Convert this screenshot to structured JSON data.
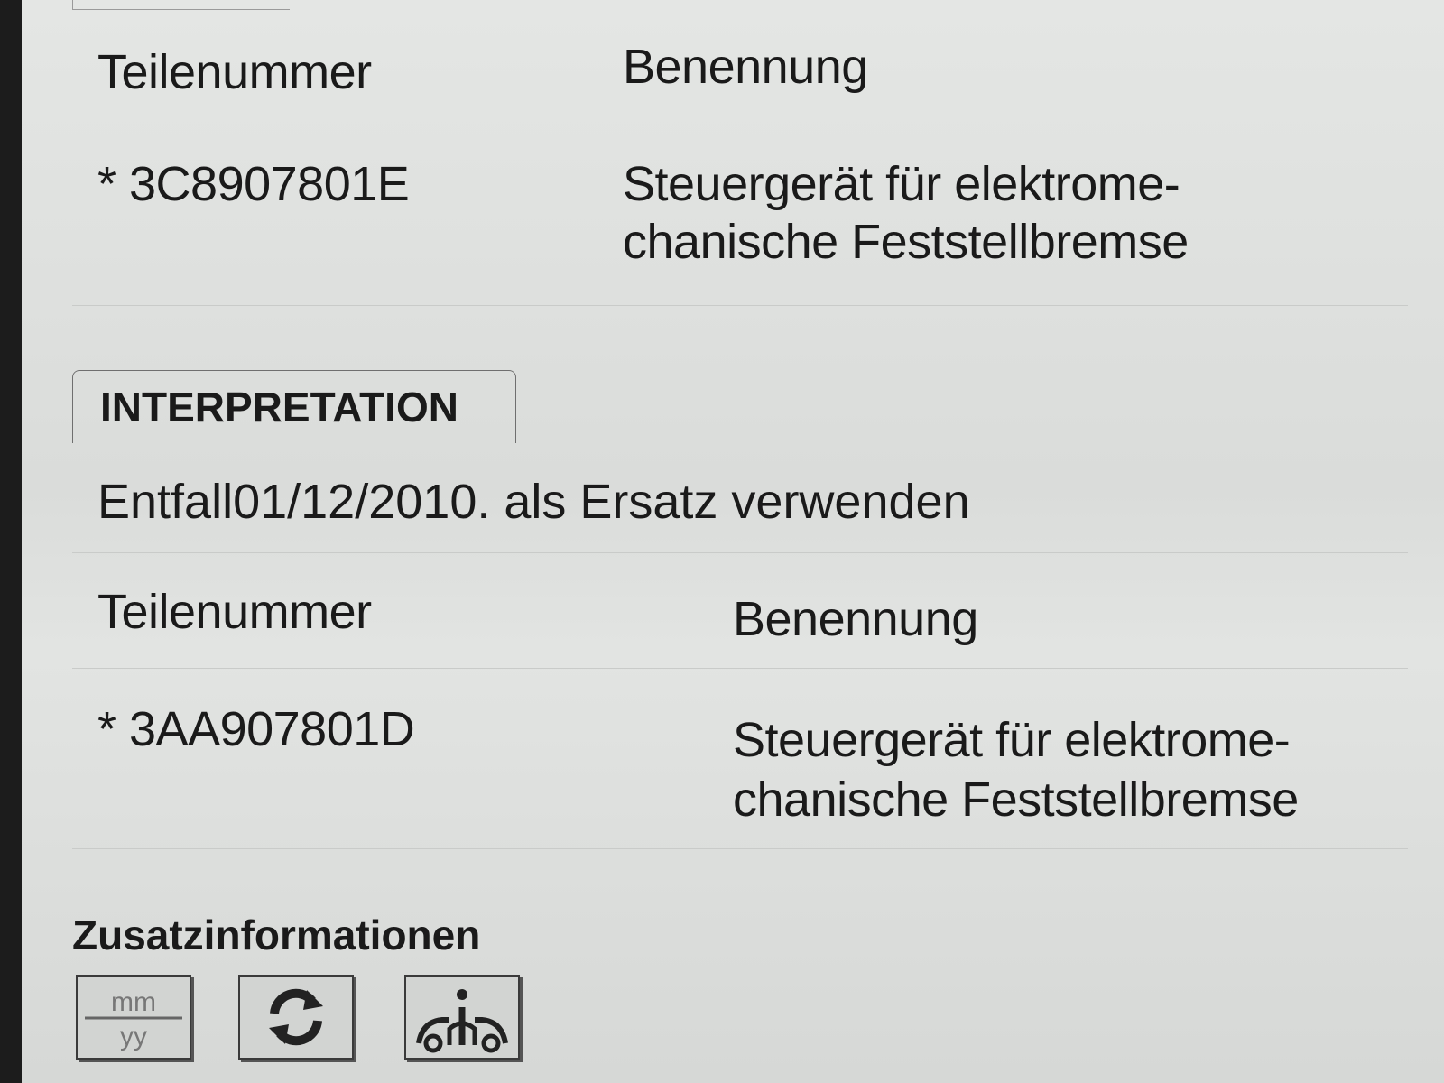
{
  "table1": {
    "header": {
      "col_number": "Teilenummer",
      "col_name": "Benennung"
    },
    "row": {
      "part_number": "* 3C8907801E",
      "name_line1": "Steuergerät für elektrome-",
      "name_line2": "chanische Feststellbremse"
    }
  },
  "interpretation": {
    "tab_label": "INTERPRETATION",
    "text": "Entfall01/12/2010. als Ersatz verwenden"
  },
  "table2": {
    "header": {
      "col_number": "Teilenummer",
      "col_name": "Benennung"
    },
    "row": {
      "part_number": "* 3AA907801D",
      "name_line1": "Steuergerät für elektrome-",
      "name_line2": "chanische Feststellbremse"
    }
  },
  "additional_info": {
    "title": "Zusatzinformationen",
    "buttons": [
      {
        "icon": "date-mm-yy-icon",
        "top_text": "mm",
        "bottom_text": "yy"
      },
      {
        "icon": "refresh-icon"
      },
      {
        "icon": "vehicle-person-icon"
      }
    ]
  }
}
